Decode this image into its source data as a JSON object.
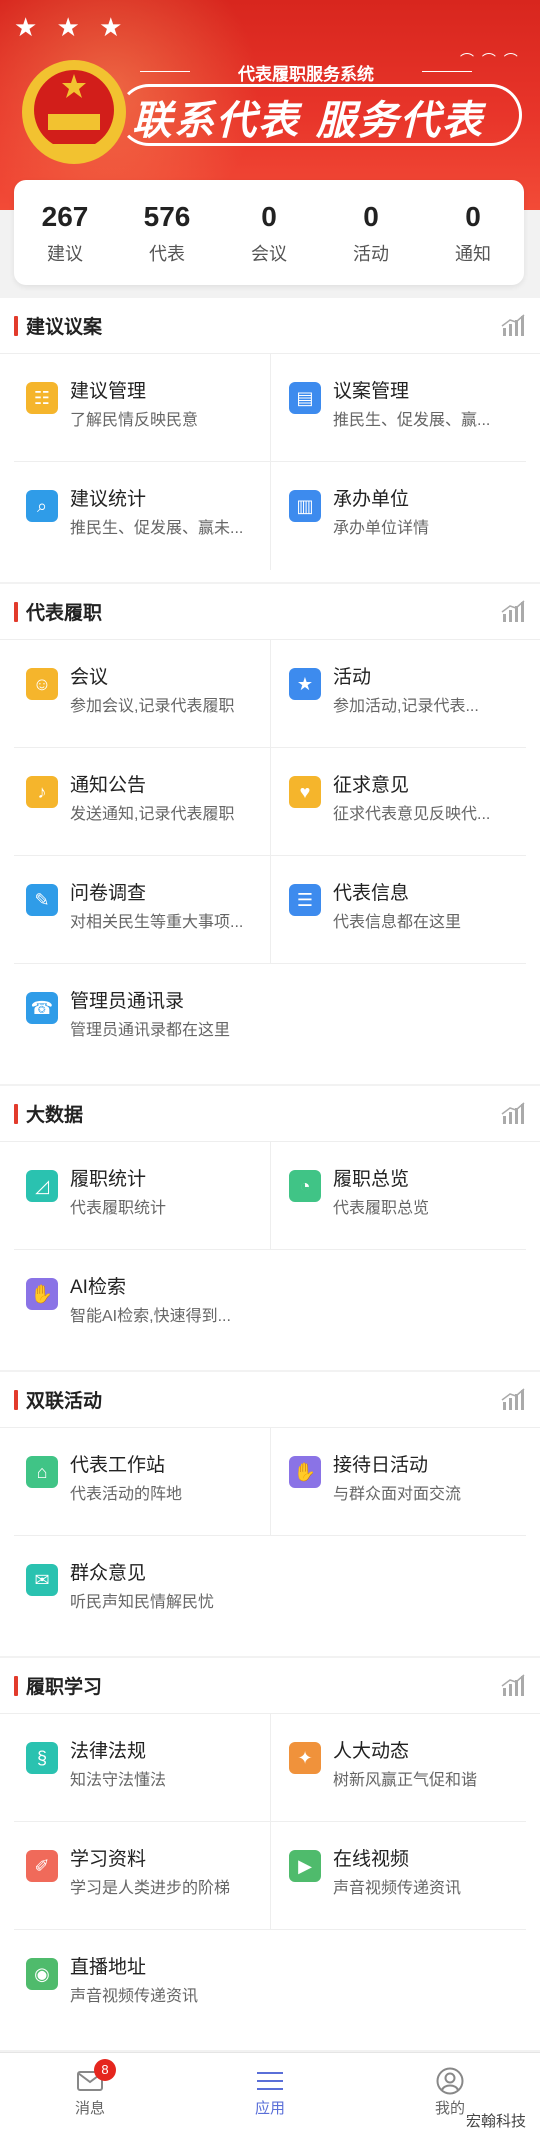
{
  "banner": {
    "system_title": "代表履职服务系统",
    "slogan": "联系代表 服务代表"
  },
  "stats": [
    {
      "value": "267",
      "label": "建议"
    },
    {
      "value": "576",
      "label": "代表"
    },
    {
      "value": "0",
      "label": "会议"
    },
    {
      "value": "0",
      "label": "活动"
    },
    {
      "value": "0",
      "label": "通知"
    }
  ],
  "sections": {
    "s1": {
      "title": "建议议案",
      "items": [
        {
          "title": "建议管理",
          "sub": "了解民情反映民意",
          "icon": "document-user-icon",
          "color": "#f5b52c"
        },
        {
          "title": "议案管理",
          "sub": "推民生、促发展、赢...",
          "icon": "folder-doc-icon",
          "color": "#3d8bee"
        },
        {
          "title": "建议统计",
          "sub": "推民生、促发展、赢未...",
          "icon": "stats-search-icon",
          "color": "#2f9ce8"
        },
        {
          "title": "承办单位",
          "sub": "承办单位详情",
          "icon": "building-icon",
          "color": "#3d8bee"
        }
      ]
    },
    "s2": {
      "title": "代表履职",
      "items": [
        {
          "title": "会议",
          "sub": "参加会议,记录代表履职",
          "icon": "meeting-icon",
          "color": "#f5b52c"
        },
        {
          "title": "活动",
          "sub": "参加活动,记录代表...",
          "icon": "star-icon",
          "color": "#3d8bee"
        },
        {
          "title": "通知公告",
          "sub": "发送通知,记录代表履职",
          "icon": "bell-icon",
          "color": "#f5b52c"
        },
        {
          "title": "征求意见",
          "sub": "征求代表意见反映代...",
          "icon": "heart-shield-icon",
          "color": "#f5b52c"
        },
        {
          "title": "问卷调查",
          "sub": "对相关民生等重大事项...",
          "icon": "survey-icon",
          "color": "#2f9ce8"
        },
        {
          "title": "代表信息",
          "sub": "代表信息都在这里",
          "icon": "profile-icon",
          "color": "#3d8bee"
        },
        {
          "title": "管理员通讯录",
          "sub": "管理员通讯录都在这里",
          "icon": "contacts-icon",
          "color": "#2f9ce8"
        }
      ]
    },
    "s3": {
      "title": "大数据",
      "items": [
        {
          "title": "履职统计",
          "sub": "代表履职统计",
          "icon": "line-chart-icon",
          "color": "#2ac2b0"
        },
        {
          "title": "履职总览",
          "sub": "代表履职总览",
          "icon": "pie-chart-icon",
          "color": "#40c486"
        },
        {
          "title": "AI检索",
          "sub": "智能AI检索,快速得到...",
          "icon": "handshake-icon",
          "color": "#8a73e6"
        }
      ]
    },
    "s4": {
      "title": "双联活动",
      "items": [
        {
          "title": "代表工作站",
          "sub": "代表活动的阵地",
          "icon": "home-icon",
          "color": "#40c486"
        },
        {
          "title": "接待日活动",
          "sub": "与群众面对面交流",
          "icon": "handshake-icon",
          "color": "#8a73e6"
        },
        {
          "title": "群众意见",
          "sub": "听民声知民情解民忧",
          "icon": "feedback-icon",
          "color": "#2ac2b0"
        }
      ]
    },
    "s5": {
      "title": "履职学习",
      "items": [
        {
          "title": "法律法规",
          "sub": "知法守法懂法",
          "icon": "law-book-icon",
          "color": "#2ac2b0"
        },
        {
          "title": "人大动态",
          "sub": "树新风赢正气促和谐",
          "icon": "news-icon",
          "color": "#f0923b"
        },
        {
          "title": "学习资料",
          "sub": "学习是人类进步的阶梯",
          "icon": "study-icon",
          "color": "#f06a5a"
        },
        {
          "title": "在线视频",
          "sub": "声音视频传递资讯",
          "icon": "video-icon",
          "color": "#4fbb6c"
        },
        {
          "title": "直播地址",
          "sub": "声音视频传递资讯",
          "icon": "live-icon",
          "color": "#4fbb6c"
        }
      ]
    }
  },
  "tabbar": {
    "messages": {
      "label": "消息",
      "badge": "8"
    },
    "apps": {
      "label": "应用"
    },
    "me": {
      "label": "我的"
    }
  },
  "watermark": "宏翰科技",
  "colors": {
    "accent": "#e23b2c",
    "tab_active": "#5a6fd8",
    "badge": "#e5261e"
  }
}
